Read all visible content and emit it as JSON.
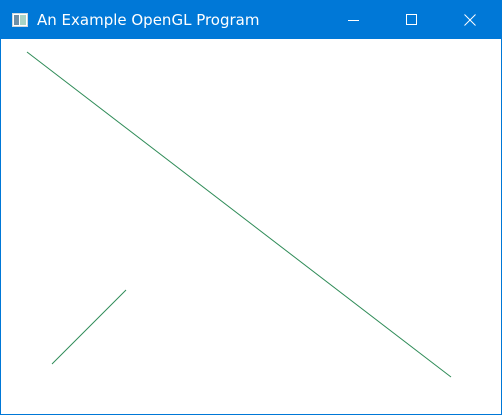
{
  "window": {
    "title": "An Example OpenGL Program",
    "titlebar_color": "#0078d7",
    "icons": {
      "app": "app-window-icon",
      "minimize": "minimize-icon",
      "maximize": "maximize-icon",
      "close": "close-icon"
    }
  },
  "canvas": {
    "background": "#ffffff",
    "line_color": "#2e8b57"
  }
}
